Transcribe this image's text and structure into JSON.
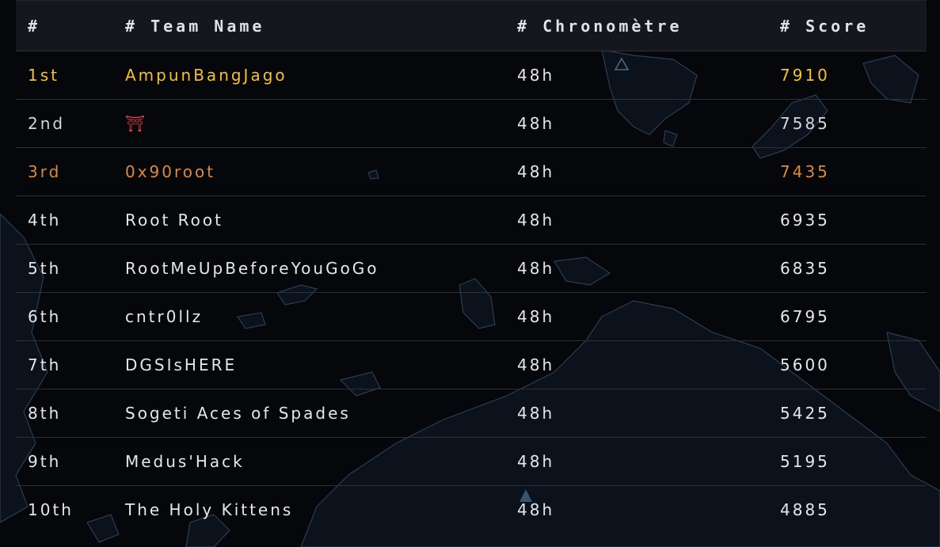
{
  "header": {
    "rank": "#",
    "team": "# Team Name",
    "time": "# Chronomètre",
    "score": "# Score"
  },
  "rows": [
    {
      "rank": "1st",
      "team": "AmpunBangJago",
      "time": "48h",
      "score": "7910"
    },
    {
      "rank": "2nd",
      "team": "⛩",
      "time": "48h",
      "score": "7585"
    },
    {
      "rank": "3rd",
      "team": "0x90root",
      "time": "48h",
      "score": "7435"
    },
    {
      "rank": "4th",
      "team": "Root Root",
      "time": "48h",
      "score": "6935"
    },
    {
      "rank": "5th",
      "team": "RootMeUpBeforeYouGoGo",
      "time": "48h",
      "score": "6835"
    },
    {
      "rank": "6th",
      "team": "cntr0llz",
      "time": "48h",
      "score": "6795"
    },
    {
      "rank": "7th",
      "team": "DGSIsHERE",
      "time": "48h",
      "score": "5600"
    },
    {
      "rank": "8th",
      "team": "Sogeti Aces of Spades",
      "time": "48h",
      "score": "5425"
    },
    {
      "rank": "9th",
      "team": "Medus'Hack",
      "time": "48h",
      "score": "5195"
    },
    {
      "rank": "10th",
      "team": "The Holy Kittens",
      "time": "48h",
      "score": "4885"
    }
  ],
  "colors": {
    "gold": "#f4c22c",
    "silver": "#d6d6dc",
    "bronze": "#dc8a3c",
    "background": "#05070b",
    "map_land": "#0c121c",
    "map_outline": "#2a3d52"
  },
  "icons": {
    "team_2_logo": "torii-gate-icon"
  }
}
